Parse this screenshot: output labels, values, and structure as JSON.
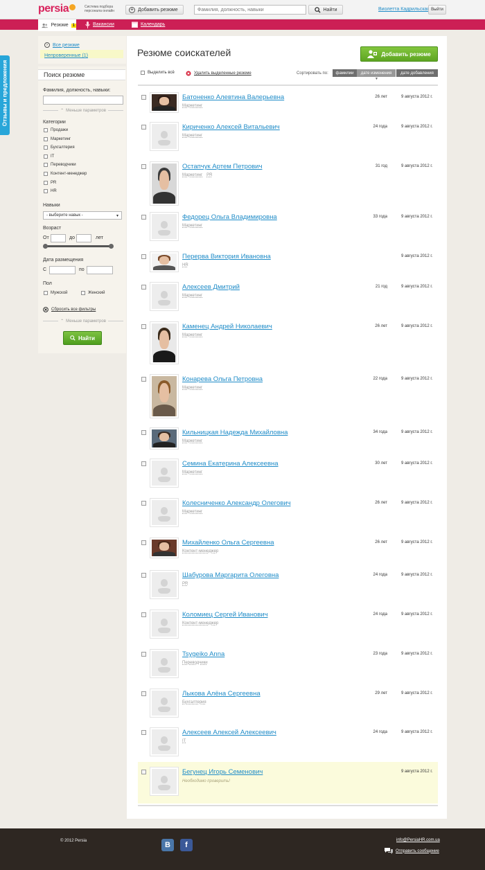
{
  "header": {
    "logo": "persia",
    "tagline": "Система подбора персонала онлайн",
    "add_resume_button": "Добавить резюме",
    "search_placeholder": "Фамилия, должность, навыки",
    "search_button": "Найти",
    "user_name": "Виолетта Кадрильская",
    "logout_button": "Выйти"
  },
  "nav": {
    "resume": "Резюме",
    "resume_badge": "1",
    "vacancies": "Вакансии",
    "calendar": "Календарь"
  },
  "feedback_tab": "Отзывы и предложения",
  "sidebar": {
    "all_resumes": "Все резюме",
    "unverified": "Непроверенные (1)",
    "search_title": "Поиск резюме",
    "query_label": "Фамилия, должность, навыки:",
    "less_params": "Меньше параметров",
    "categories_label": "Категории",
    "categories": [
      "Продажи",
      "Маркетинг",
      "Бухгалтерия",
      "IT",
      "Переводчики",
      "Контент-менеджер",
      "PR",
      "HR"
    ],
    "skills_label": "Навыки",
    "skills_select": "- выберите навык -",
    "age_label": "Возраст",
    "age_from": "От",
    "age_to": "до",
    "age_unit": "лет",
    "date_label": "Дата размещения",
    "date_from": "С",
    "date_to": "по",
    "gender_label": "Пол",
    "gender_male": "Мужской",
    "gender_female": "Женский",
    "reset_filters": "Сбросить все фильтры",
    "less_params_2": "Меньше параметров",
    "find_button": "Найти"
  },
  "main": {
    "title": "Резюме соискателей",
    "add_resume_button": "Добавить резюме",
    "select_all": "Выделить всё",
    "delete_selected": "Удалить выделенные резюме",
    "sort_label": "Сортировать по:",
    "sort_by_name": "фамилии",
    "sort_by_changed": "дате изменения",
    "sort_by_added": "дате добавления"
  },
  "resumes": [
    {
      "name": "Батоненко Алевтина Валерьевна",
      "categories": [
        "Маркетинг"
      ],
      "age": "26 лет",
      "date": "9 августа 2012 г."
    },
    {
      "name": "Кириченко Алексей Витальевич",
      "categories": [
        "Маркетинг"
      ],
      "age": "24 года",
      "date": "9 августа 2012 г."
    },
    {
      "name": "Остапчук Артем Петрович",
      "categories": [
        "Маркетинг",
        "PR"
      ],
      "age": "31 год",
      "date": "9 августа 2012 г."
    },
    {
      "name": "Федорец Ольга Владимировна",
      "categories": [
        "Маркетинг"
      ],
      "age": "33 года",
      "date": "9 августа 2012 г."
    },
    {
      "name": "Перерва Виктория Ивановна",
      "categories": [
        "HR"
      ],
      "age": "",
      "date": "9 августа 2012 г."
    },
    {
      "name": "Алексеев Дмитрий",
      "categories": [
        "Маркетинг"
      ],
      "age": "21 год",
      "date": "9 августа 2012 г."
    },
    {
      "name": "Каменец Андрей Николаевич",
      "categories": [
        "Маркетинг"
      ],
      "age": "26 лет",
      "date": "9 августа 2012 г."
    },
    {
      "name": "Конарева Ольга Петровна",
      "categories": [
        "Маркетинг"
      ],
      "age": "22 года",
      "date": "9 августа 2012 г."
    },
    {
      "name": "Кильницкая Надежда Михайловна",
      "categories": [
        "Маркетинг"
      ],
      "age": "34 года",
      "date": "9 августа 2012 г."
    },
    {
      "name": "Семина Екатерина Алексеевна",
      "categories": [
        "Маркетинг"
      ],
      "age": "30 лет",
      "date": "9 августа 2012 г."
    },
    {
      "name": "Колесниченко Александр Олегович",
      "categories": [
        "Маркетинг"
      ],
      "age": "26 лет",
      "date": "9 августа 2012 г."
    },
    {
      "name": "Михайленко Ольга Сергеевна",
      "categories": [
        "Контент-менеджер"
      ],
      "age": "26 лет",
      "date": "9 августа 2012 г."
    },
    {
      "name": "Шабурова Маргарита Олеговна",
      "categories": [
        "PR"
      ],
      "age": "24 года",
      "date": "9 августа 2012 г."
    },
    {
      "name": "Коломиец Сергей Иванович",
      "categories": [
        "Контент-менеджер"
      ],
      "age": "24 года",
      "date": "9 августа 2012 г."
    },
    {
      "name": "Tsygeiko Anna",
      "categories": [
        "Переводчики"
      ],
      "age": "23 года",
      "date": "9 августа 2012 г."
    },
    {
      "name": "Лыкова Алёна Сергеевна",
      "categories": [
        "Бухгалтерия"
      ],
      "age": "29 лет",
      "date": "9 августа 2012 г."
    },
    {
      "name": "Алексеев Алексей Алексеевич",
      "categories": [
        "IT"
      ],
      "age": "24 года",
      "date": "9 августа 2012 г."
    },
    {
      "name": "Бегунец Игорь Семенович",
      "categories": [],
      "age": "",
      "date": "9 августа 2012 г.",
      "warning": "Необходимо проверить!"
    }
  ],
  "footer": {
    "copyright": "© 2012 Persia",
    "vk": "B",
    "fb": "f",
    "email": "info@PersiaHR.com.ua",
    "send_message": "Отправить сообщение"
  }
}
